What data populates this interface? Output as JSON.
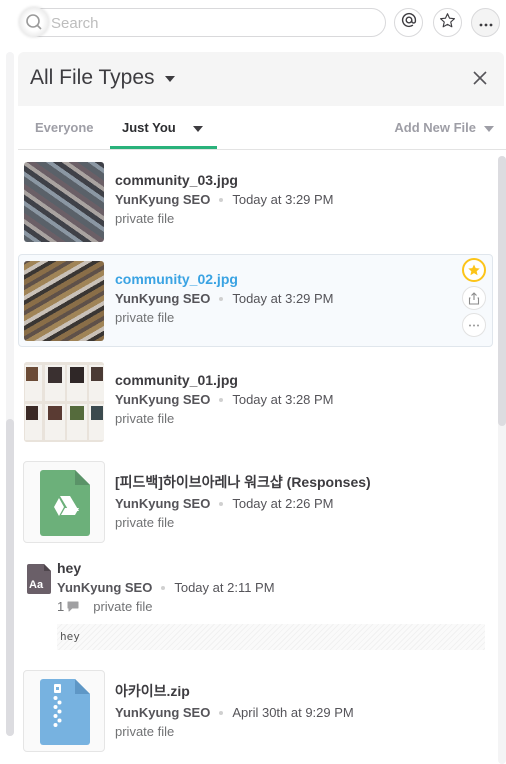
{
  "search": {
    "placeholder": "Search"
  },
  "toolbar": {
    "mentions_icon": "at-sign-icon",
    "starred_icon": "star-outline-icon",
    "more_icon": "ellipsis-icon"
  },
  "panel": {
    "title": "All File Types",
    "close_icon": "close-icon"
  },
  "tabs": {
    "items": [
      {
        "label": "Everyone",
        "active": false
      },
      {
        "label": "Just You",
        "active": true
      }
    ],
    "add_new_file": "Add New File",
    "active_color": "#2ab27b"
  },
  "files": [
    {
      "name": "community_03.jpg",
      "author": "YunKyung SEO",
      "time": "Today at 3:29 PM",
      "privacy": "private file",
      "type": "image"
    },
    {
      "name": "community_02.jpg",
      "author": "YunKyung SEO",
      "time": "Today at 3:29 PM",
      "privacy": "private file",
      "type": "image",
      "starred": true,
      "hovered": true
    },
    {
      "name": "community_01.jpg",
      "author": "YunKyung SEO",
      "time": "Today at 3:28 PM",
      "privacy": "private file",
      "type": "image"
    },
    {
      "name": "[피드백]하이브아레나 워크샵 (Responses)",
      "author": "YunKyung SEO",
      "time": "Today at 2:26 PM",
      "privacy": "private file",
      "type": "google-drive"
    },
    {
      "name": "hey",
      "author": "YunKyung SEO",
      "time": "Today at 2:11 PM",
      "privacy": "private file",
      "type": "snippet",
      "comments": "1",
      "preview": "hey",
      "icon_label": "Aa"
    },
    {
      "name": "아카이브.zip",
      "author": "YunKyung SEO",
      "time": "April 30th at 9:29 PM",
      "privacy": "private file",
      "type": "zip"
    }
  ],
  "colors": {
    "link": "#3aa3e3",
    "star": "#fcc419",
    "gdrive": "#6cb07a",
    "zip": "#77b2e0",
    "snippet": "#6a5f68"
  }
}
